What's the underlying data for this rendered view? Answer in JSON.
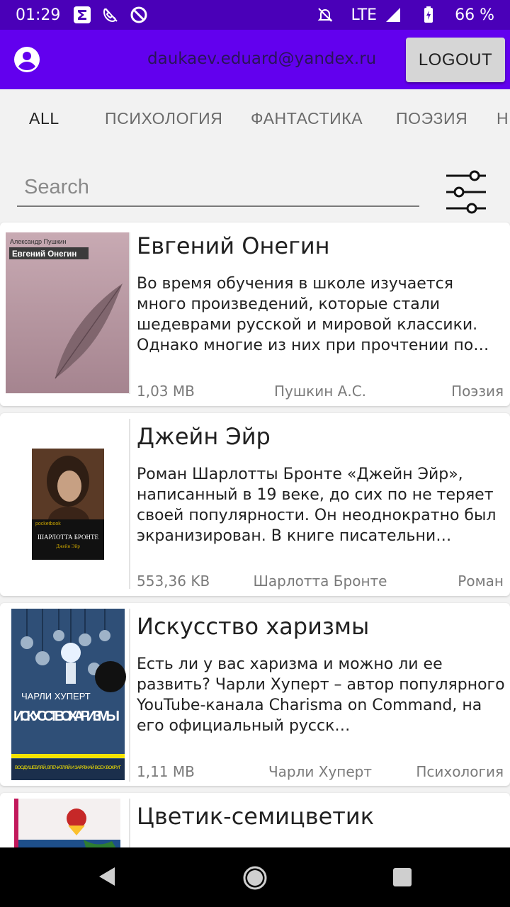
{
  "status_bar": {
    "time": "01:29",
    "network": "LTE",
    "battery": "66 %",
    "icons": [
      "sigma-app-icon",
      "phone-off-icon",
      "blocked-icon",
      "mute-icon",
      "signal-icon",
      "battery-icon"
    ]
  },
  "app_bar": {
    "email": "daukaev.eduard@yandex.ru",
    "logout_label": "LOGOUT",
    "colors": {
      "app_bar": "#6200ee",
      "status_bar": "#4a00b8"
    }
  },
  "tabs": [
    {
      "label": "ALL",
      "active": true
    },
    {
      "label": "ПСИХОЛОГИЯ",
      "active": false
    },
    {
      "label": "ФАНТАСТИКА",
      "active": false
    },
    {
      "label": "ПОЭЗИЯ",
      "active": false
    },
    {
      "label": "Н",
      "active": false
    }
  ],
  "search": {
    "placeholder": "Search",
    "value": ""
  },
  "books": [
    {
      "title": "Евгений Онегин",
      "description": "Во время обучения в школе изучается много произведений, которые стали шедеврами русской и мировой классики. Однако многие из них при прочтении по…",
      "size": "1,03 MB",
      "author": "Пушкин А.С.",
      "genre": "Поэзия",
      "cover": {
        "author": "Александр Пушкин",
        "title": "Евгений Онегин",
        "bg": "#b89aa5"
      }
    },
    {
      "title": "Джейн Эйр",
      "description": "Роман Шарлотты Бронте «Джейн Эйр», написанный в 19 веке, до сих по не теряет своей популярности. Он неоднократно был экранизирован. В книге писательни…",
      "size": "553,36 KB",
      "author": "Шарлотта Бронте",
      "genre": "Роман",
      "cover": {
        "author": "ШАРЛОТТА БРОНТЕ",
        "title": "Джейн Эйр",
        "series": "pocketbook",
        "bg": "#111"
      }
    },
    {
      "title": "Искусство харизмы",
      "description": "Есть ли у вас харизма и можно ли ее развить? Чарли Хуперт – автор популярного YouTube-канала Charisma on Command, на его официальный русск…",
      "size": "1,11 MB",
      "author": "Чарли Хуперт",
      "genre": "Психология",
      "cover": {
        "author": "ЧАРЛИ ХУПЕРТ",
        "title": "ИСКУССТВО ХАРИЗМЫ",
        "tagline": "ВООДУШЕВЛЯЙ, ВПЕЧАТЛЯЙ И ЗАРЯЖАЙ ВСЕХ ВОКРУГ",
        "bg": "#2f4f77"
      }
    },
    {
      "title": "Цветик-семицветик",
      "description": "",
      "size": "",
      "author": "",
      "genre": "",
      "cover": {
        "bg": "#f4f0f0"
      }
    }
  ]
}
